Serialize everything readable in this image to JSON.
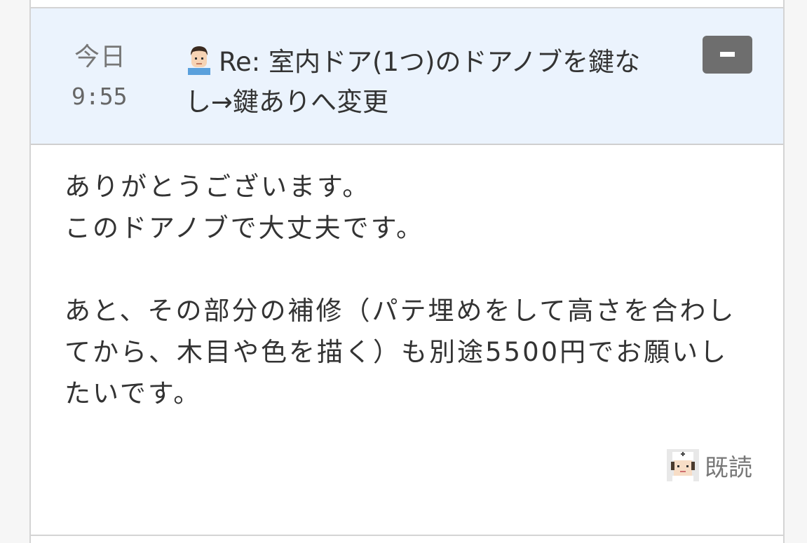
{
  "message": {
    "date_label": "今日",
    "time": "9:55",
    "sender_icon": "man-avatar-icon",
    "subject": "Re: 室内ドア(1つ)のドアノブを鍵なし→鍵ありへ変更",
    "collapse_icon": "minus-icon",
    "body": "ありがとうございます。\nこのドアノブで大丈夫です。\n\nあと、その部分の補修（パテ埋めをして高さを合わしてから、木目や色を描く）も別途5500円でお願いしたいです。",
    "read_icon": "nurse-avatar-icon",
    "read_label": "既読"
  },
  "colors": {
    "header_bg": "#ebf3fd",
    "button_bg": "#6e6e6e",
    "text": "#333333",
    "muted": "#777777"
  }
}
